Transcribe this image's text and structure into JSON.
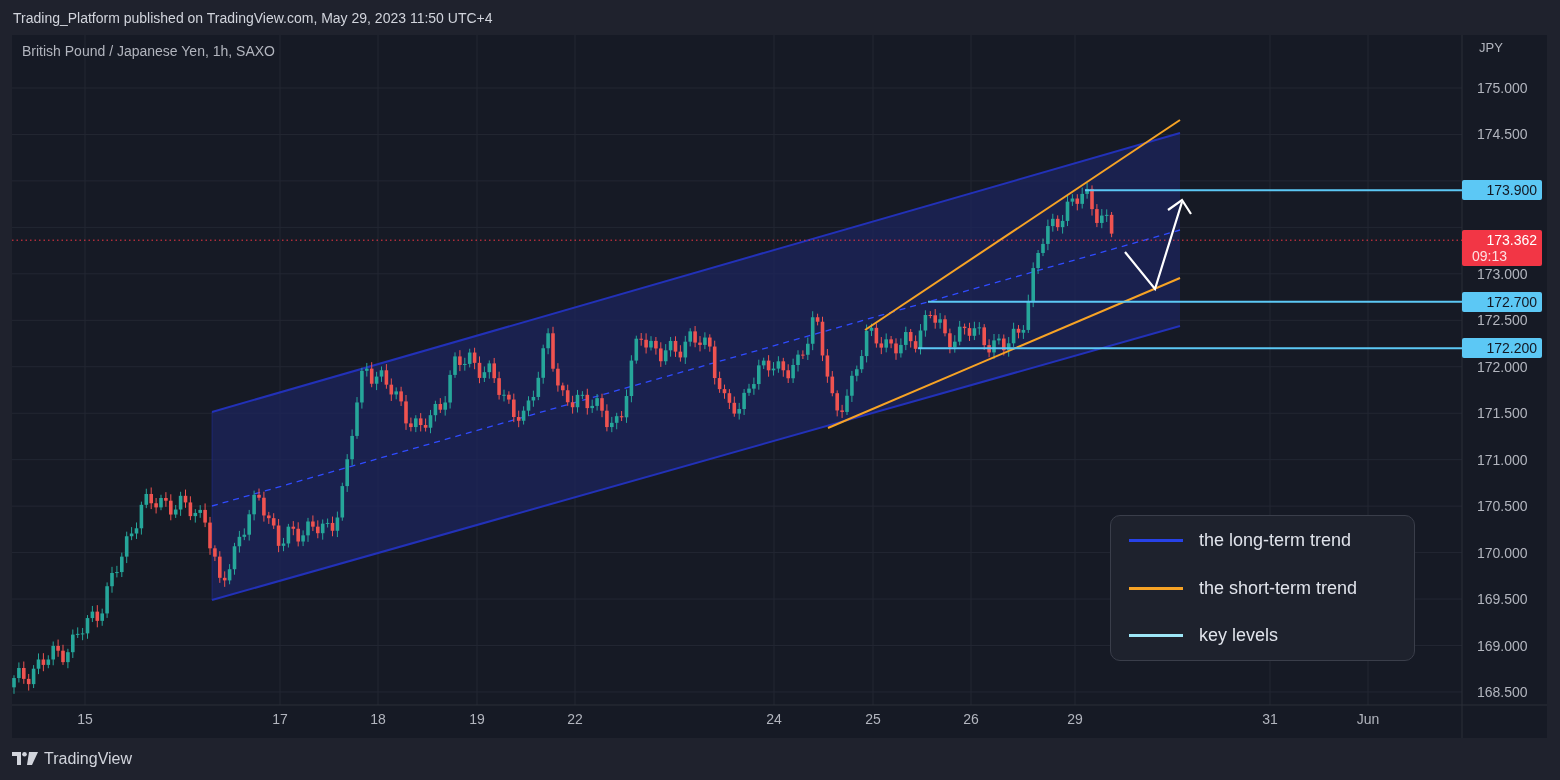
{
  "header": {
    "publisher_line": "Trading_Platform published on TradingView.com, May 29, 2023 11:50 UTC+4"
  },
  "chart": {
    "symbol": "British Pound / Japanese Yen, 1h, SAXO",
    "currency": "JPY",
    "price_ticks": [
      "175.000",
      "174.500",
      "173.000",
      "172.500",
      "172.000",
      "171.500",
      "171.000",
      "170.500",
      "170.000",
      "169.500",
      "169.000",
      "168.500"
    ],
    "time_ticks": [
      "15",
      "17",
      "18",
      "19",
      "22",
      "24",
      "25",
      "26",
      "29",
      "31",
      "Jun"
    ],
    "key_levels": [
      {
        "label": "173.900"
      },
      {
        "label": "172.700"
      },
      {
        "label": "172.200"
      }
    ],
    "last_price": {
      "price": "173.362",
      "countdown": "09:13"
    },
    "legend": [
      {
        "label": "the long-term trend",
        "color": "#2742e8"
      },
      {
        "label": "the short-term trend",
        "color": "#f7a325"
      },
      {
        "label": "key levels",
        "color": "#9ee7f7"
      }
    ]
  },
  "footer": {
    "brand": "TradingView"
  }
}
